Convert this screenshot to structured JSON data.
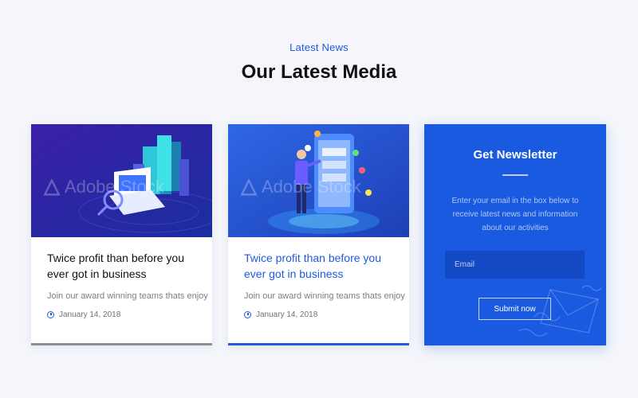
{
  "header": {
    "kicker": "Latest News",
    "title": "Our Latest Media"
  },
  "cards": [
    {
      "title": "Twice profit than before you ever got in business",
      "excerpt": "Join our award winning teams thats enjoy",
      "date": "January 14, 2018",
      "watermark": "Adobe Stock"
    },
    {
      "title": "Twice profit than before you ever got in business",
      "excerpt": "Join our award winning teams thats enjoy",
      "date": "January 14, 2018",
      "watermark": "Adobe Stock"
    }
  ],
  "newsletter": {
    "title": "Get Newsletter",
    "description": "Enter your email in the box below to receive latest news and information about our activities",
    "email_placeholder": "Email",
    "submit_label": "Submit now"
  },
  "colors": {
    "accent": "#1f5bdc",
    "newsletter_bg": "#1a5ae0",
    "page_bg": "#f4f6fb"
  },
  "icons": [
    "clock-icon",
    "adobe-logo-icon",
    "envelope-icon"
  ]
}
